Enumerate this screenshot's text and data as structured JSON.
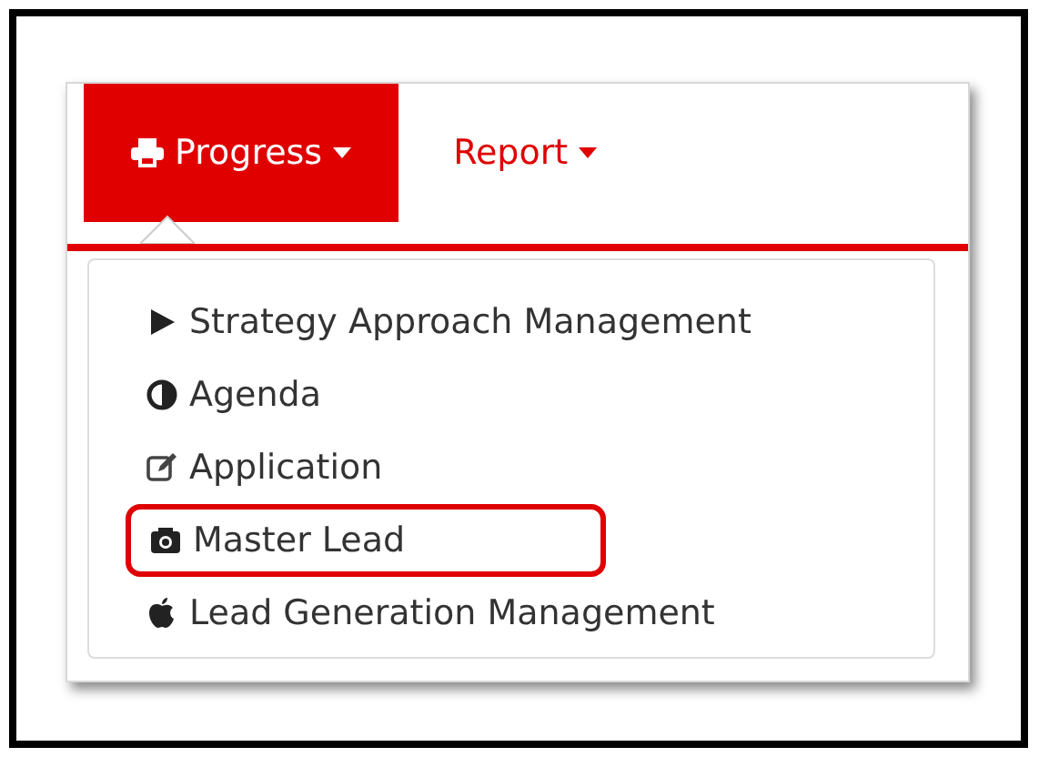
{
  "tabs": [
    {
      "label": "Progress",
      "selected": true
    },
    {
      "label": "Report",
      "selected": false
    }
  ],
  "dropdown": {
    "items": [
      {
        "label": "Strategy Approach Management",
        "highlighted": false
      },
      {
        "label": "Agenda",
        "highlighted": false
      },
      {
        "label": "Application",
        "highlighted": false
      },
      {
        "label": "Master Lead",
        "highlighted": true
      },
      {
        "label": "Lead Generation Management",
        "highlighted": false
      }
    ]
  }
}
